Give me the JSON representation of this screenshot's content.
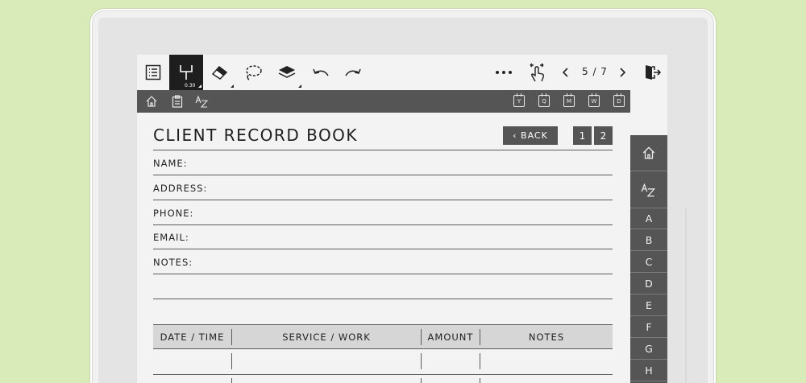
{
  "toolbar": {
    "pen_size": "0.30",
    "page_indicator": "5 / 7",
    "icons": [
      "toc-icon",
      "pen-icon",
      "eraser-icon",
      "lasso-icon",
      "layers-icon",
      "undo-icon",
      "redo-icon",
      "more-icon",
      "touch-gesture-icon",
      "prev-page-icon",
      "next-page-icon",
      "exit-icon"
    ]
  },
  "navbar": {
    "left_icons": [
      "home-icon",
      "clipboard-icon",
      "az-icon"
    ],
    "calendar_tabs": [
      "Y",
      "Q",
      "M",
      "W",
      "D"
    ]
  },
  "page": {
    "title": "CLIENT RECORD BOOK",
    "back_label": "‹ BACK",
    "page_buttons": [
      "1",
      "2"
    ],
    "fields": {
      "name": "NAME:",
      "address": "ADDRESS:",
      "phone": "PHONE:",
      "email": "EMAIL:",
      "notes": "NOTES:"
    },
    "table": {
      "headers": [
        "DATE / TIME",
        "SERVICE / WORK",
        "AMOUNT",
        "NOTES"
      ]
    }
  },
  "sidebar": {
    "az_label": "AZ",
    "letters": [
      "A",
      "B",
      "C",
      "D",
      "E",
      "F",
      "G",
      "H"
    ]
  },
  "colors": {
    "background": "#d9ebb8",
    "dark_bar": "#555555",
    "active_tool": "#1e1e1e"
  }
}
